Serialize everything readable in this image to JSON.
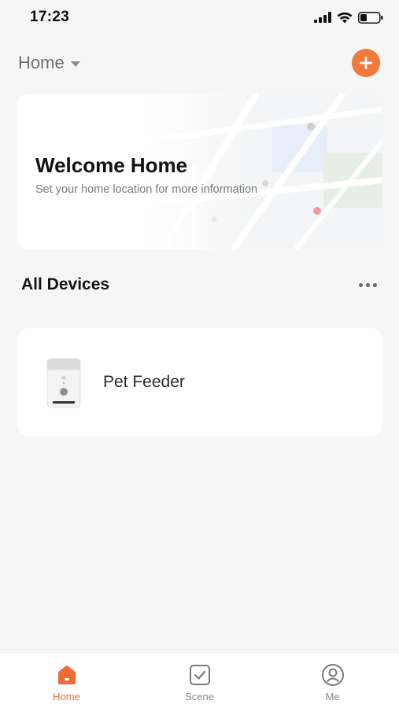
{
  "status_bar": {
    "time": "17:23",
    "icons": [
      "signal-icon",
      "wifi-icon",
      "battery-icon"
    ]
  },
  "header": {
    "home_label": "Home",
    "add_icon": "plus-icon"
  },
  "welcome": {
    "title": "Welcome Home",
    "subtitle": "Set your home location for more information"
  },
  "devices": {
    "section_title": "All Devices",
    "more_icon": "more-icon",
    "items": [
      {
        "name": "Pet Feeder",
        "icon": "pet-feeder-icon"
      }
    ]
  },
  "tabs": [
    {
      "label": "Home",
      "icon": "home-icon",
      "active": true
    },
    {
      "label": "Scene",
      "icon": "scene-icon",
      "active": false
    },
    {
      "label": "Me",
      "icon": "profile-icon",
      "active": false
    }
  ],
  "colors": {
    "accent": "#ef7a3c",
    "background": "#f6f6f6",
    "card": "#ffffff",
    "tab_active": "#ef6a35",
    "tab_inactive": "#8a8a8a"
  }
}
